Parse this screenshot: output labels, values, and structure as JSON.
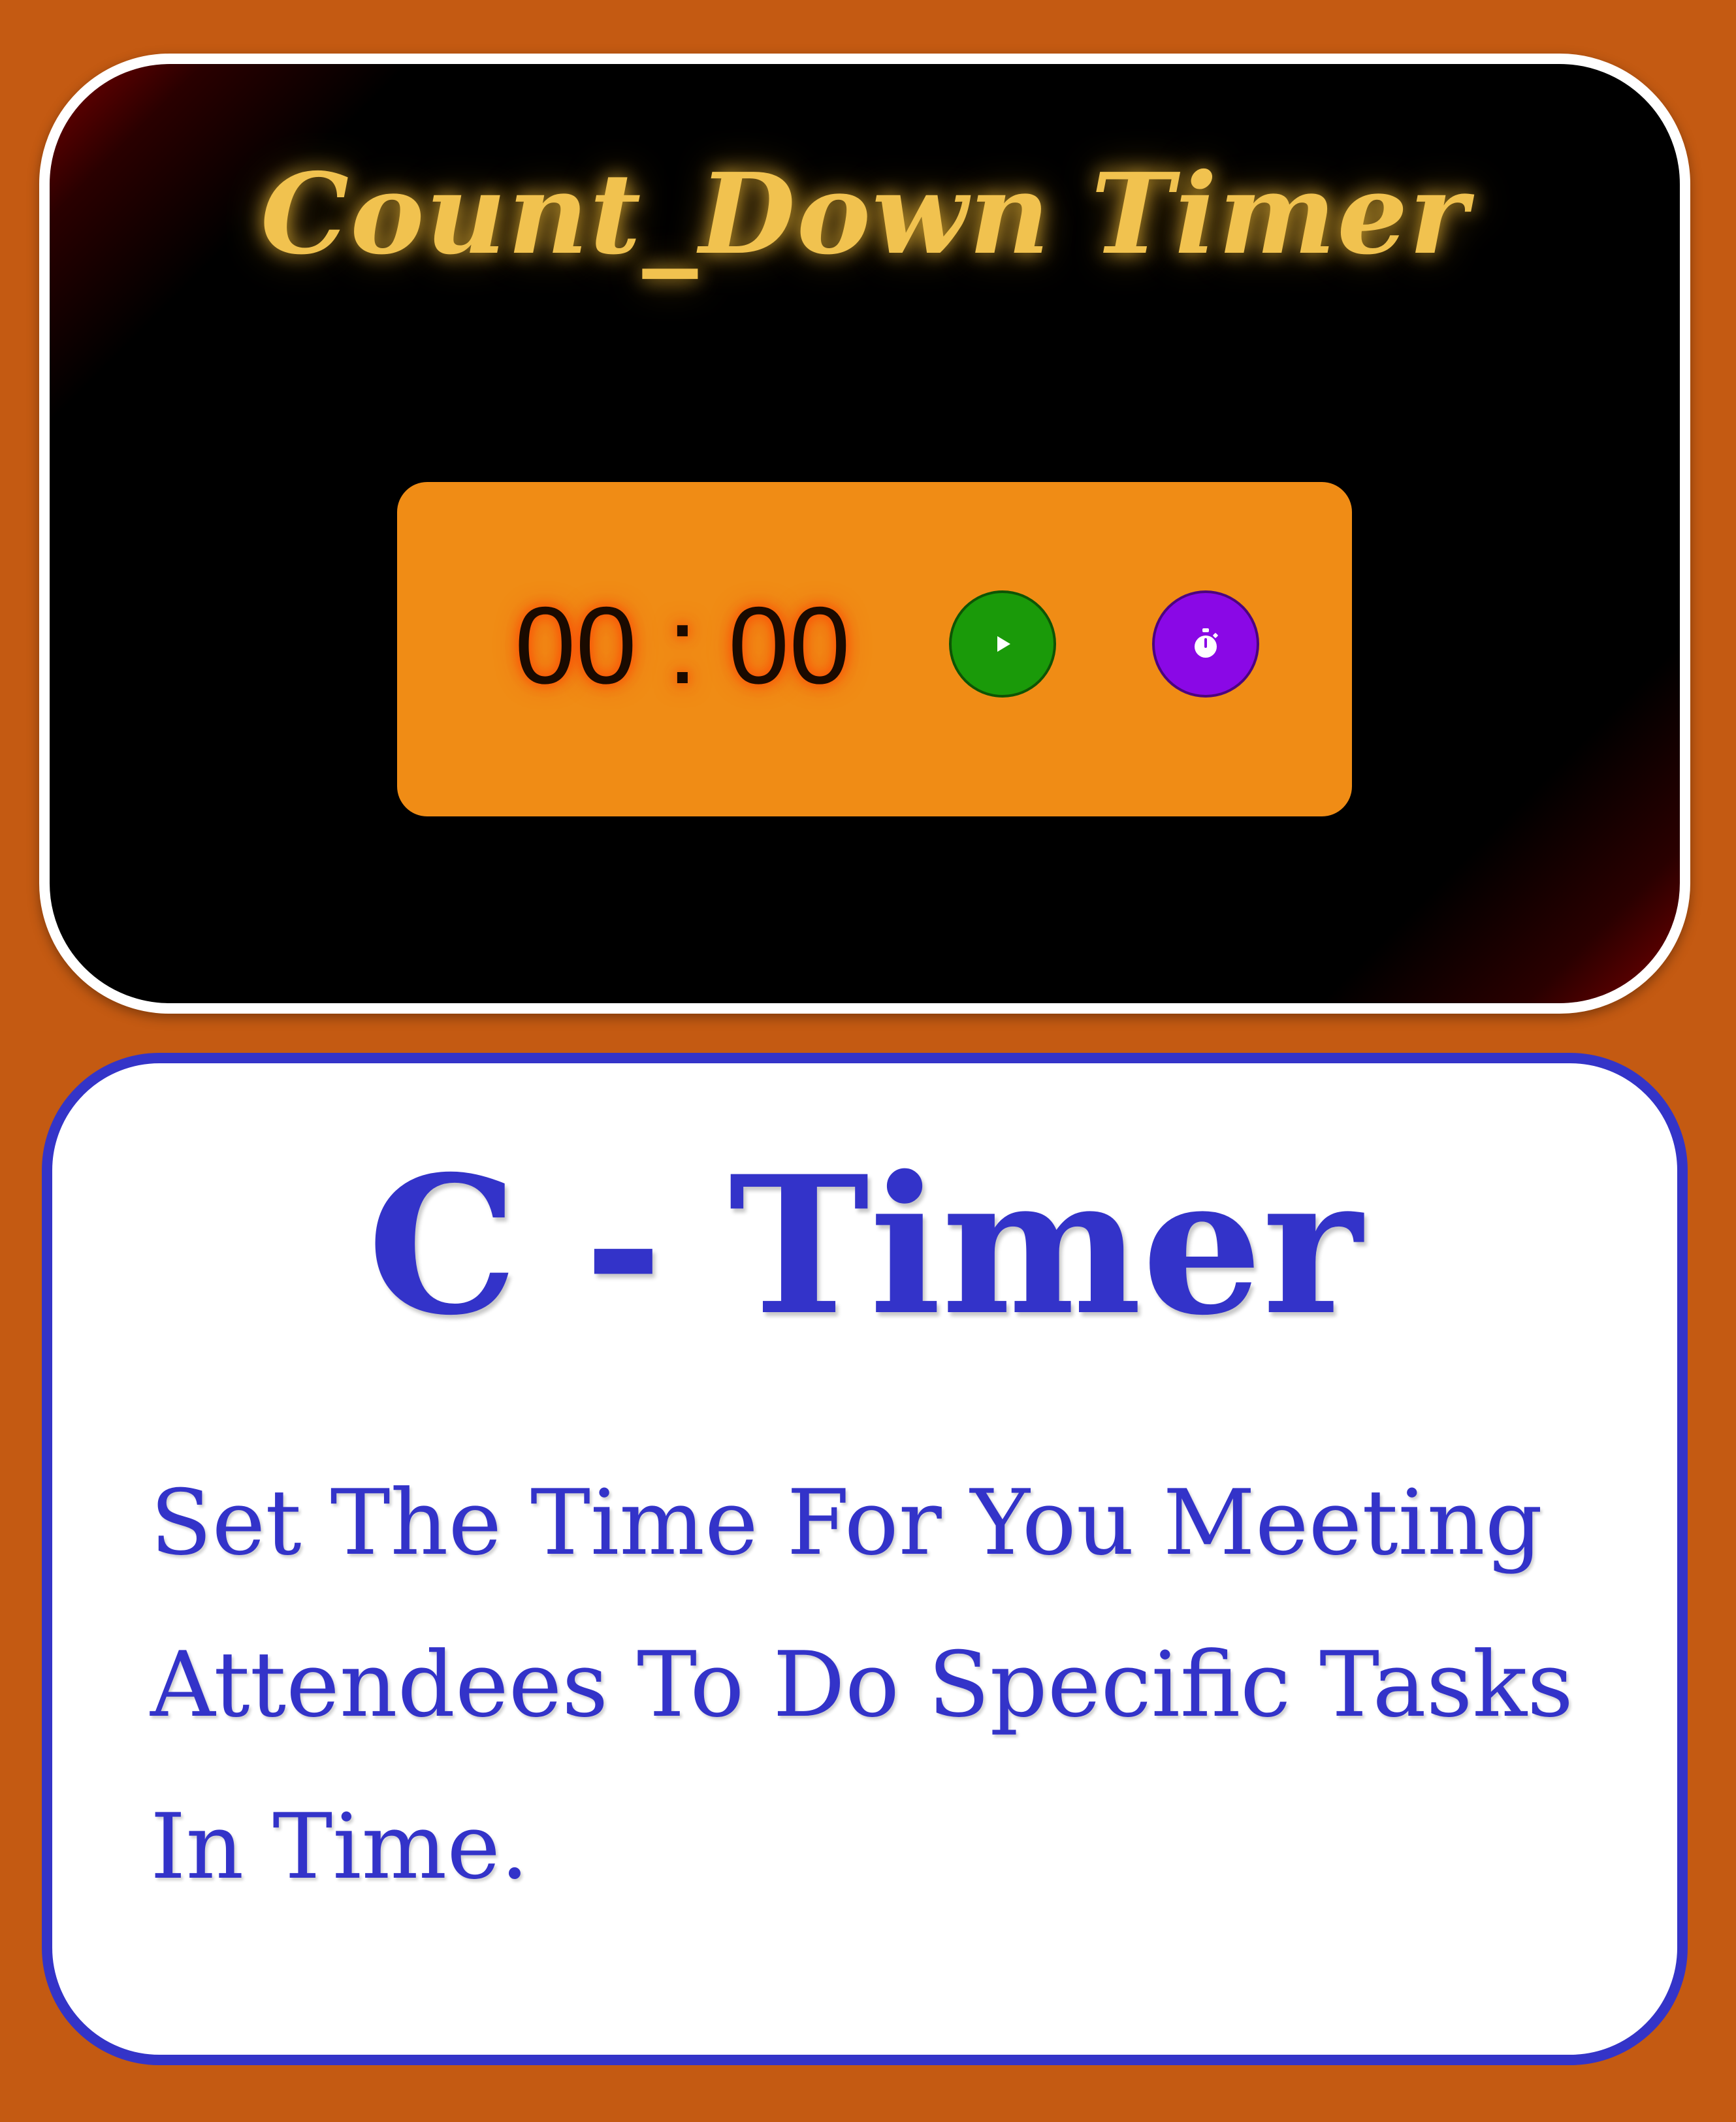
{
  "app": {
    "title": "Count_Down Timer",
    "timer": {
      "display": "00 : 00",
      "play_icon": "play-icon",
      "stopwatch_icon": "stopwatch-icon"
    }
  },
  "info": {
    "heading": "C - Timer",
    "description": "Set The Time For You Meeting Attendees To Do Specific Tasks In Time."
  },
  "colors": {
    "background": "#c45a12",
    "title_gold": "#f1c24f",
    "panel_orange": "#f08c15",
    "play_green": "#1a9a09",
    "stopwatch_purple": "#8a08e6",
    "info_blue": "#3333c9"
  }
}
